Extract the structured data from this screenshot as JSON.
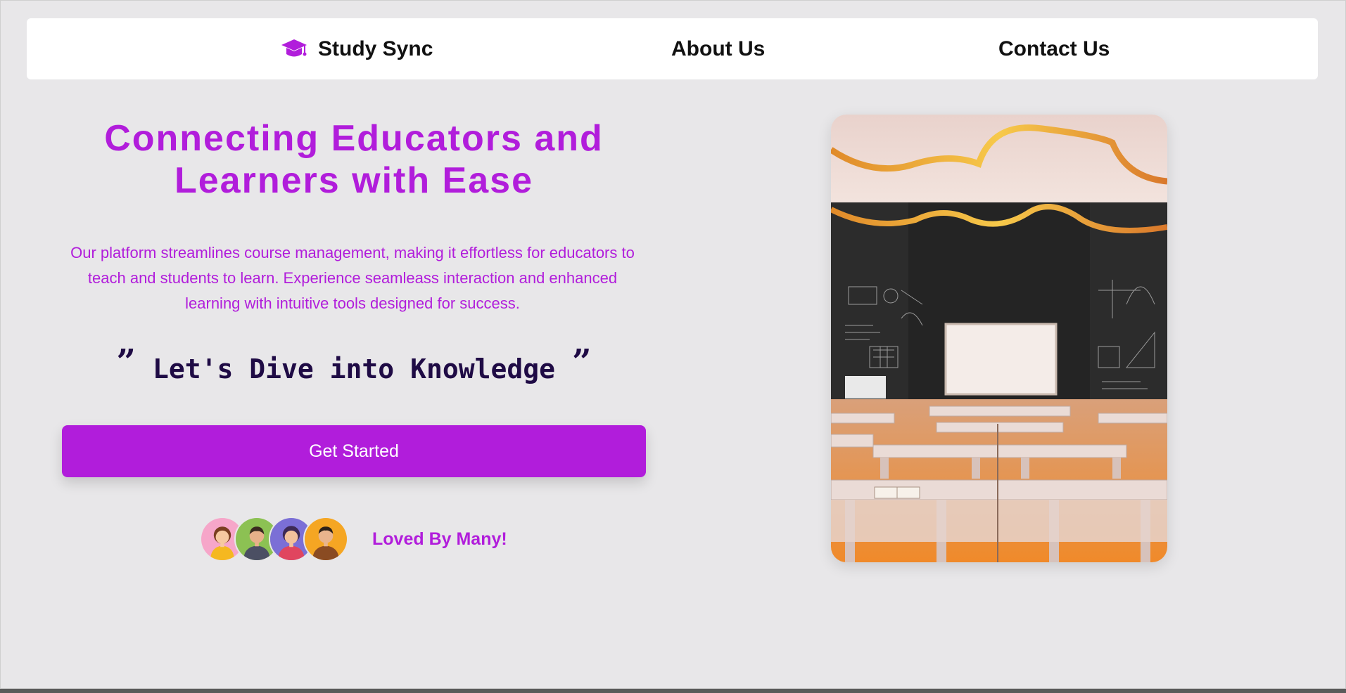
{
  "nav": {
    "brand": "Study Sync",
    "brand_icon": "graduation-cap-icon",
    "about": "About Us",
    "contact": "Contact Us"
  },
  "hero": {
    "title": "Connecting Educators and Learners with Ease",
    "description": "Our platform streamlines course management, making it effortless for educators to teach and students to learn. Experience seamleass interaction and enhanced learning with intuitive tools designed for success.",
    "quote_open": "”",
    "quote_text": "Let's Dive into Knowledge",
    "quote_close": "”",
    "cta": "Get Started",
    "loved": "Loved By Many!"
  },
  "colors": {
    "accent": "#b11ddb",
    "quote": "#1f0b45",
    "page_bg": "#e8e7e9",
    "nav_bg": "#ffffff"
  },
  "image": {
    "description_icon": "classroom-photo"
  }
}
